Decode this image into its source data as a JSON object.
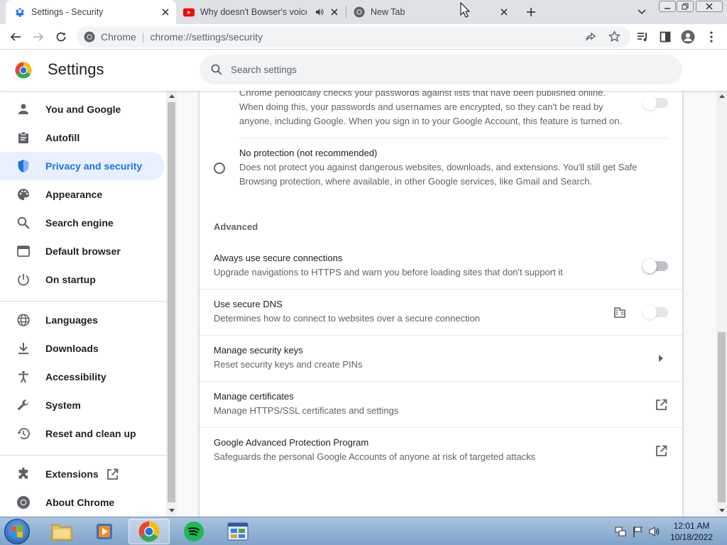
{
  "browser": {
    "tabs": [
      {
        "title": "Settings - Security",
        "favicon": "gear-icon",
        "active": true
      },
      {
        "title": "Why doesn't Bowser's voice",
        "favicon": "youtube-icon",
        "active": false,
        "audio": "speaker-icon"
      },
      {
        "title": "New Tab",
        "favicon": "chrome-icon",
        "active": false
      }
    ],
    "omnibox": {
      "site_label": "Chrome",
      "url": "chrome://settings/security"
    }
  },
  "settings": {
    "title": "Settings",
    "search_placeholder": "Search settings"
  },
  "sidebar": {
    "items": [
      {
        "label": "You and Google",
        "icon": "person-icon"
      },
      {
        "label": "Autofill",
        "icon": "clipboard-icon"
      },
      {
        "label": "Privacy and security",
        "icon": "shield-icon",
        "active": true
      },
      {
        "label": "Appearance",
        "icon": "palette-icon"
      },
      {
        "label": "Search engine",
        "icon": "search-icon"
      },
      {
        "label": "Default browser",
        "icon": "browser-icon"
      },
      {
        "label": "On startup",
        "icon": "power-icon"
      },
      {
        "label": "Languages",
        "icon": "globe-icon"
      },
      {
        "label": "Downloads",
        "icon": "download-icon"
      },
      {
        "label": "Accessibility",
        "icon": "accessibility-icon"
      },
      {
        "label": "System",
        "icon": "wrench-icon"
      },
      {
        "label": "Reset and clean up",
        "icon": "history-icon"
      },
      {
        "label": "Extensions",
        "icon": "puzzle-icon"
      },
      {
        "label": "About Chrome",
        "icon": "chrome-icon"
      }
    ]
  },
  "content": {
    "password_check_desc_1": "Chrome periodically checks your passwords against lists that have been published online.",
    "password_check_desc_2": "When doing this, your passwords and usernames are encrypted, so they can't be read by",
    "password_check_desc_3": "anyone, including Google. When you sign in to your Google Account, this feature is turned on.",
    "no_protection": {
      "title": "No protection (not recommended)",
      "desc_1": "Does not protect you against dangerous websites, downloads, and extensions. You'll still get Safe",
      "desc_2": "Browsing protection, where available, in other Google services, like Gmail and Search."
    },
    "advanced_heading": "Advanced",
    "rows": [
      {
        "title": "Always use secure connections",
        "desc": "Upgrade navigations to HTTPS and warn you before loading sites that don't support it",
        "control": "toggle-off"
      },
      {
        "title": "Use secure DNS",
        "desc": "Determines how to connect to websites over a secure connection",
        "control": "toggle-disabled",
        "icon": "enterprise-building-icon"
      },
      {
        "title": "Manage security keys",
        "desc": "Reset security keys and create PINs",
        "control": "chevron-right-icon"
      },
      {
        "title": "Manage certificates",
        "desc": "Manage HTTPS/SSL certificates and settings",
        "control": "open-external-icon"
      },
      {
        "title": "Google Advanced Protection Program",
        "desc": "Safeguards the personal Google Accounts of anyone at risk of targeted attacks",
        "control": "open-external-icon"
      }
    ]
  },
  "taskbar": {
    "apps": [
      "file-explorer-icon",
      "media-player-icon",
      "chrome-icon",
      "spotify-icon",
      "control-panel-icon"
    ],
    "clock_time": "12:01 AM",
    "clock_date": "10/18/2022"
  },
  "colors": {
    "accent": "#1a73e8",
    "active_nav_bg": "#e8f0fe",
    "youtube_red": "#ff0000",
    "spotify_green": "#1db954"
  }
}
